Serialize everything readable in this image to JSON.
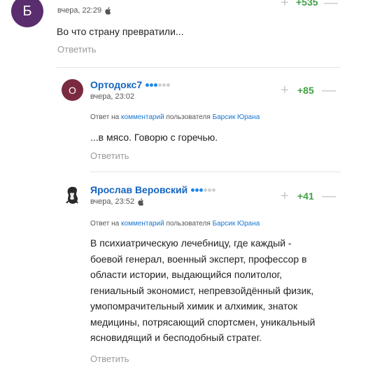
{
  "comment1": {
    "avatar_letter": "Б",
    "time": "вчера, 22:29",
    "score": "+535",
    "text": "Во что страну превратили...",
    "reply_label": "Ответить"
  },
  "comment2": {
    "avatar_letter": "О",
    "author": "Ортодокс7",
    "time": "вчера, 23:02",
    "score": "+85",
    "reply_to": {
      "prefix": "Ответ на",
      "link": "комментарий",
      "middle": "пользователя",
      "user": "Барсик Юрана"
    },
    "text": "...в мясо. Говорю с горечью.",
    "reply_label": "Ответить",
    "rating_dots_filled": 3,
    "rating_dots_total": 6
  },
  "comment3": {
    "author": "Ярослав Веровский",
    "time": "вчера, 23:52",
    "score": "+41",
    "reply_to": {
      "prefix": "Ответ на",
      "link": "комментарий",
      "middle": "пользователя",
      "user": "Барсик Юрана"
    },
    "text_lines": [
      "В психиатрическую лечебницу, где каждый -",
      "боевой генерал, военный эксперт, профессор в",
      "области истории, выдающийся политолог,",
      "гениальный экономист, непревзойдённый физик,",
      "умопомрачительный химик и алхимик, знаток",
      "медицины, потрясающий спортсмен, уникальный",
      "ясновидящий и бесподобный стратег."
    ],
    "reply_label": "Ответить",
    "rating_dots_filled": 3,
    "rating_dots_total": 6
  },
  "vote": {
    "plus": "+",
    "minus": "—"
  },
  "colors": {
    "author_link": "#1565c0",
    "score_positive": "#43a047",
    "dot_filled": "#1e88e5",
    "dot_empty": "#cfcfcf"
  }
}
